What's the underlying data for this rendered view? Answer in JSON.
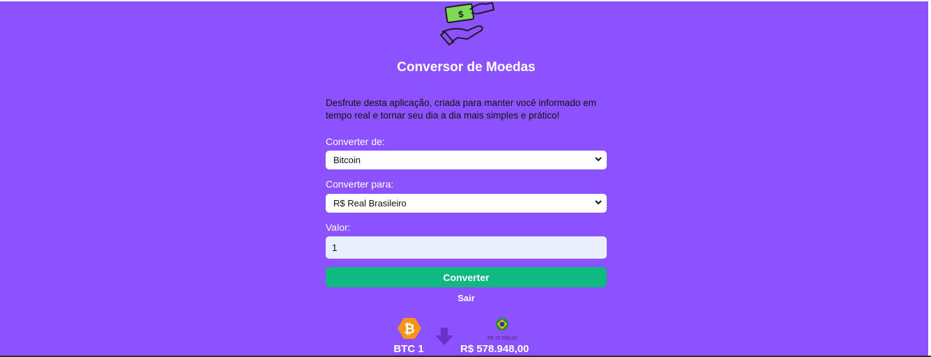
{
  "header": {
    "title": "Conversor de Moedas",
    "description": "Desfrute desta aplicação, criada para manter você informado em tempo real e tornar seu dia a dia mais simples e prático!"
  },
  "form": {
    "from_label": "Converter de:",
    "from_selected": "Bitcoin",
    "to_label": "Converter para:",
    "to_selected": "R$ Real Brasileiro",
    "value_label": "Valor:",
    "value": "1",
    "convert_button": "Converter",
    "exit_link": "Sair"
  },
  "result": {
    "from_text": "BTC 1",
    "to_text": "R$ 578.948,00",
    "real_note": "R$ 10.000,00"
  },
  "colors": {
    "background": "#8c52ff",
    "button": "#10b981",
    "input_fill": "#e8f0fe",
    "bitcoin": "#f7931a"
  },
  "icons": {
    "header_illustration": "hand-giving-money-illustration",
    "from_currency": "bitcoin-icon",
    "arrow": "arrow-down-icon",
    "to_currency": "brazil-real-icon",
    "select_chevron": "chevron-down-icon"
  }
}
